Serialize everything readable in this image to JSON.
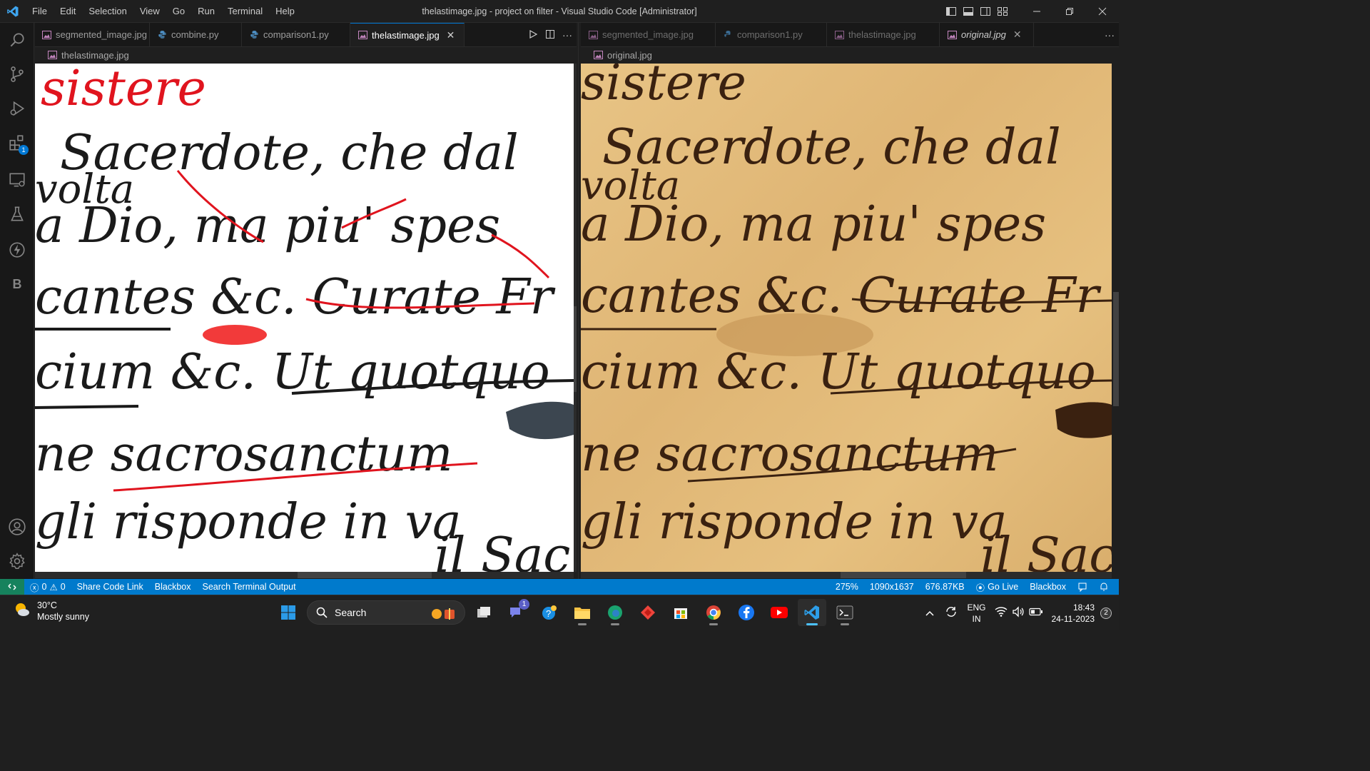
{
  "window": {
    "title": "thelastimage.jpg - project on filter - Visual Studio Code [Administrator]",
    "menu": [
      "File",
      "Edit",
      "Selection",
      "View",
      "Go",
      "Run",
      "Terminal",
      "Help"
    ]
  },
  "editor_left": {
    "tabs": [
      {
        "label": "segmented_image.jpg",
        "type": "image"
      },
      {
        "label": "combine.py",
        "type": "python"
      },
      {
        "label": "comparison1.py",
        "type": "python"
      },
      {
        "label": "thelastimage.jpg",
        "type": "image",
        "active": true
      }
    ],
    "breadcrumb": "thelastimage.jpg"
  },
  "editor_right": {
    "tabs": [
      {
        "label": "segmented_image.jpg",
        "type": "image"
      },
      {
        "label": "comparison1.py",
        "type": "python"
      },
      {
        "label": "thelastimage.jpg",
        "type": "image"
      },
      {
        "label": "original.jpg",
        "type": "image",
        "active": true
      }
    ],
    "breadcrumb": "original.jpg"
  },
  "manuscript_lines": [
    "sistere",
    "Sacerdote, che dal",
    "volta",
    "a Dio, ma piu' spes",
    "cantes &c. Curate Fr",
    "cium &c. Ut quotquo",
    "ne sacrosanctum",
    "gli risponde in va",
    "il Sac"
  ],
  "activity_bar": {
    "extensions_badge": "1",
    "letter_item": "B"
  },
  "status": {
    "errors": "0",
    "warnings": "0",
    "left_items": [
      "Share Code Link",
      "Blackbox",
      "Search Terminal Output"
    ],
    "zoom": "275%",
    "dimensions": "1090x1637",
    "filesize": "676.87KB",
    "go_live": "Go Live",
    "blackbox": "Blackbox"
  },
  "taskbar": {
    "temperature": "30°C",
    "weather": "Mostly sunny",
    "search_label": "Search",
    "teams_badge": "1",
    "lang_line1": "ENG",
    "lang_line2": "IN",
    "time": "18:43",
    "date": "24-11-2023",
    "notification_count": "2"
  },
  "colors": {
    "accent": "#007acc",
    "remote": "#16825d",
    "ink_red": "#e0141e",
    "ink_dark": "#1a1a1a",
    "ink_brown": "#3a2110"
  }
}
